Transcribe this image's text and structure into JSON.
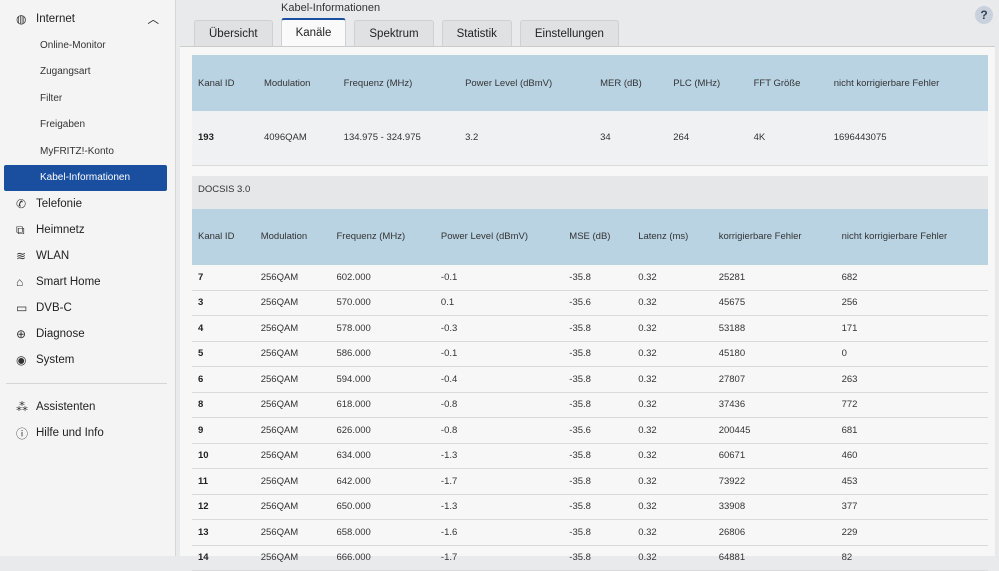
{
  "sidebar": {
    "internet": "Internet",
    "internet_sub": [
      "Online-Monitor",
      "Zugangsart",
      "Filter",
      "Freigaben",
      "MyFRITZ!-Konto",
      "Kabel-Informationen"
    ],
    "items": [
      {
        "label": "Telefonie",
        "icon": "phone-icon",
        "glyph": "✆"
      },
      {
        "label": "Heimnetz",
        "icon": "network-icon",
        "glyph": "⧉"
      },
      {
        "label": "WLAN",
        "icon": "wifi-icon",
        "glyph": "≋"
      },
      {
        "label": "Smart Home",
        "icon": "smart-home-icon",
        "glyph": "⌂"
      },
      {
        "label": "DVB-C",
        "icon": "tv-icon",
        "glyph": "▭"
      },
      {
        "label": "Diagnose",
        "icon": "diagnose-icon",
        "glyph": "⊕"
      },
      {
        "label": "System",
        "icon": "system-icon",
        "glyph": "◉"
      }
    ],
    "bottom": [
      {
        "label": "Assistenten",
        "icon": "wizard-icon",
        "glyph": "⁂"
      },
      {
        "label": "Hilfe und Info",
        "icon": "help-icon",
        "glyph": "ⓘ"
      }
    ]
  },
  "header": {
    "title": "Kabel-Informationen",
    "help": "?"
  },
  "tabs": [
    "Übersicht",
    "Kanäle",
    "Spektrum",
    "Statistik",
    "Einstellungen"
  ],
  "docsis31": {
    "headers": [
      "Kanal ID",
      "Modulation",
      "Frequenz (MHz)",
      "Power Level (dBmV)",
      "MER (dB)",
      "PLC (MHz)",
      "FFT Größe",
      "nicht korrigierbare Fehler"
    ],
    "rows": [
      [
        "193",
        "4096QAM",
        "134.975 - 324.975",
        "3.2",
        "34",
        "264",
        "4K",
        "1696443075"
      ]
    ]
  },
  "docsis30": {
    "title": "DOCSIS 3.0",
    "headers": [
      "Kanal ID",
      "Modulation",
      "Frequenz (MHz)",
      "Power Level (dBmV)",
      "MSE (dB)",
      "Latenz (ms)",
      "korrigierbare Fehler",
      "nicht korrigierbare Fehler"
    ],
    "rows": [
      [
        "7",
        "256QAM",
        "602.000",
        "-0.1",
        "-35.8",
        "0.32",
        "25281",
        "682"
      ],
      [
        "3",
        "256QAM",
        "570.000",
        "0.1",
        "-35.6",
        "0.32",
        "45675",
        "256"
      ],
      [
        "4",
        "256QAM",
        "578.000",
        "-0.3",
        "-35.8",
        "0.32",
        "53188",
        "171"
      ],
      [
        "5",
        "256QAM",
        "586.000",
        "-0.1",
        "-35.8",
        "0.32",
        "45180",
        "0"
      ],
      [
        "6",
        "256QAM",
        "594.000",
        "-0.4",
        "-35.8",
        "0.32",
        "27807",
        "263"
      ],
      [
        "8",
        "256QAM",
        "618.000",
        "-0.8",
        "-35.8",
        "0.32",
        "37436",
        "772"
      ],
      [
        "9",
        "256QAM",
        "626.000",
        "-0.8",
        "-35.6",
        "0.32",
        "200445",
        "681"
      ],
      [
        "10",
        "256QAM",
        "634.000",
        "-1.3",
        "-35.8",
        "0.32",
        "60671",
        "460"
      ],
      [
        "11",
        "256QAM",
        "642.000",
        "-1.7",
        "-35.8",
        "0.32",
        "73922",
        "453"
      ],
      [
        "12",
        "256QAM",
        "650.000",
        "-1.3",
        "-35.8",
        "0.32",
        "33908",
        "377"
      ],
      [
        "13",
        "256QAM",
        "658.000",
        "-1.6",
        "-35.8",
        "0.32",
        "26806",
        "229"
      ],
      [
        "14",
        "256QAM",
        "666.000",
        "-1.7",
        "-35.8",
        "0.32",
        "64881",
        "82"
      ]
    ]
  }
}
